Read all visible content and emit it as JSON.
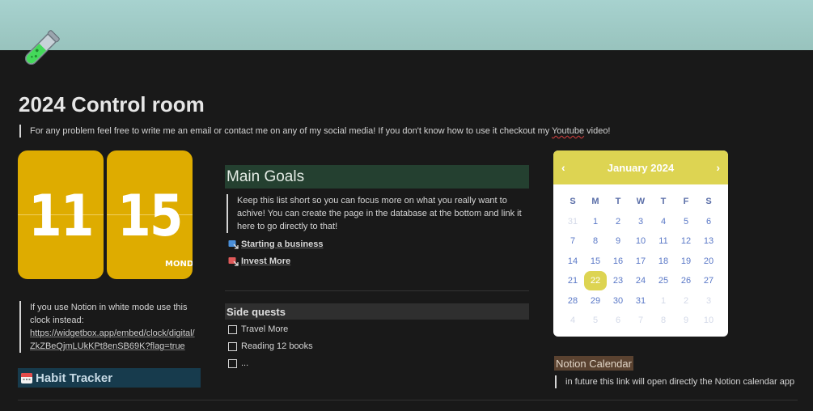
{
  "page": {
    "title": "2024 Control room",
    "intro_text": "For any problem feel free to write me an email or contact me on any of my social media! If you don't know how to use it checkout my ",
    "intro_link": "Youtube",
    "intro_end": " video!"
  },
  "clock": {
    "hours": "11",
    "minutes": "15",
    "day": "MONDAY",
    "color": "#deac00",
    "note_text": "If you use Notion in white mode use this clock instead:",
    "note_url": "https://widgetbox.app/embed/clock/digital/ZkZBeQjmLUkKPt8enSB69K?flag=true"
  },
  "habit_tracker": {
    "label": "Habit Tracker",
    "icon": "calendar-icon"
  },
  "main_goals": {
    "heading": "Main Goals",
    "description": "Keep this list short so you can focus more on what you really want to achive! You can create the page in the database at the bottom and link it here to go directly to that!",
    "links": [
      {
        "label": "Starting a business",
        "icon": "page-link-icon"
      },
      {
        "label": "Invest More",
        "icon": "page-link-icon"
      }
    ]
  },
  "side_quests": {
    "heading": "Side quests",
    "items": [
      {
        "label": "Travel More",
        "checked": false
      },
      {
        "label": "Reading 12 books",
        "checked": false
      },
      {
        "label": "...",
        "checked": false
      }
    ]
  },
  "calendar": {
    "month": "January 2024",
    "prev": "‹",
    "next": "›",
    "accent": "#ddd452",
    "weekdays": [
      "S",
      "M",
      "T",
      "W",
      "T",
      "F",
      "S"
    ],
    "weeks": [
      [
        "31",
        "1",
        "2",
        "3",
        "4",
        "5",
        "6"
      ],
      [
        "7",
        "8",
        "9",
        "10",
        "11",
        "12",
        "13"
      ],
      [
        "14",
        "15",
        "16",
        "17",
        "18",
        "19",
        "20"
      ],
      [
        "21",
        "22",
        "23",
        "24",
        "25",
        "26",
        "27"
      ],
      [
        "28",
        "29",
        "30",
        "31",
        "1",
        "2",
        "3"
      ],
      [
        "4",
        "5",
        "6",
        "7",
        "8",
        "9",
        "10"
      ]
    ],
    "today": "22"
  },
  "notion_calendar": {
    "label": "Notion Calendar",
    "note": "in future this link will open directly the Notion calendar app"
  }
}
